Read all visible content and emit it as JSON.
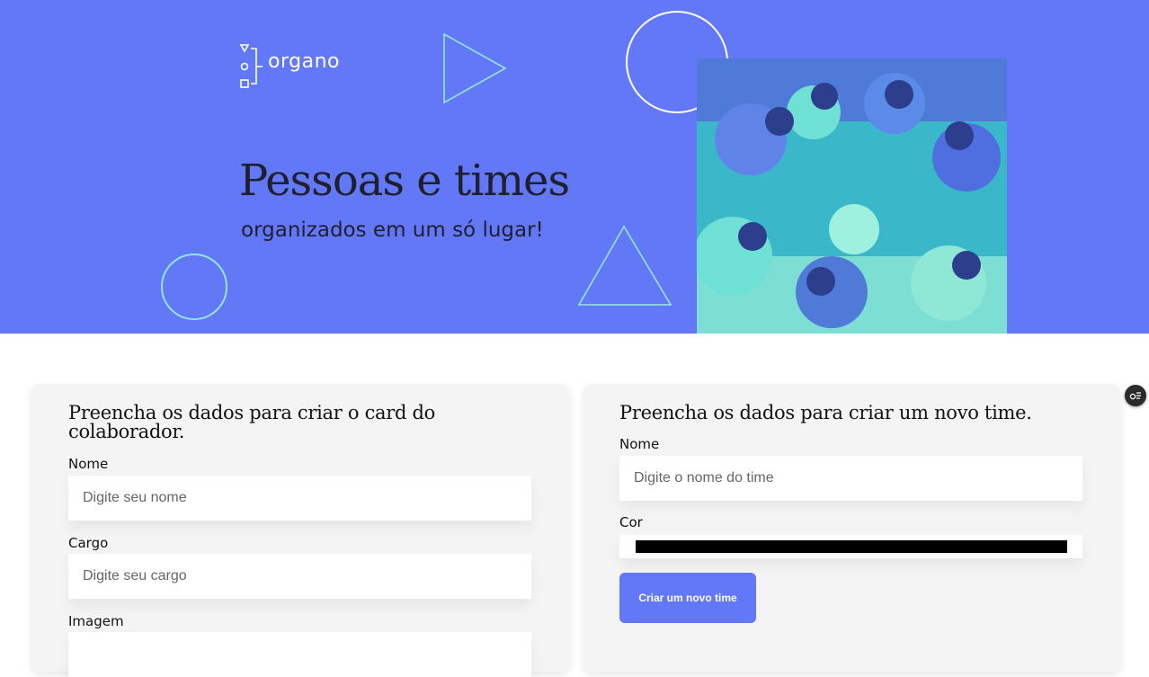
{
  "banner": {
    "logo_text": "organo",
    "title": "Pessoas e times",
    "subtitle": "organizados em um só lugar!",
    "photo": "team-hands-together-photo"
  },
  "colaborador_form": {
    "title": "Preencha os dados para criar o card do colaborador.",
    "fields": [
      {
        "label": "Nome",
        "placeholder": "Digite seu nome",
        "value": ""
      },
      {
        "label": "Cargo",
        "placeholder": "Digite seu cargo",
        "value": ""
      },
      {
        "label": "Imagem",
        "placeholder": "",
        "value": ""
      }
    ]
  },
  "time_form": {
    "title": "Preencha os dados para criar um novo time.",
    "name_label": "Nome",
    "name_placeholder": "Digite o nome do time",
    "name_value": "",
    "color_label": "Cor",
    "color_value": "#000000",
    "submit_label": "Criar um novo time"
  },
  "colors": {
    "banner": "#6278f7",
    "accent_shapes": "#8fe8d6",
    "panel": "#f4f4f4",
    "button": "#6278f7"
  },
  "extension": {
    "icon": "browser-extension-icon"
  }
}
